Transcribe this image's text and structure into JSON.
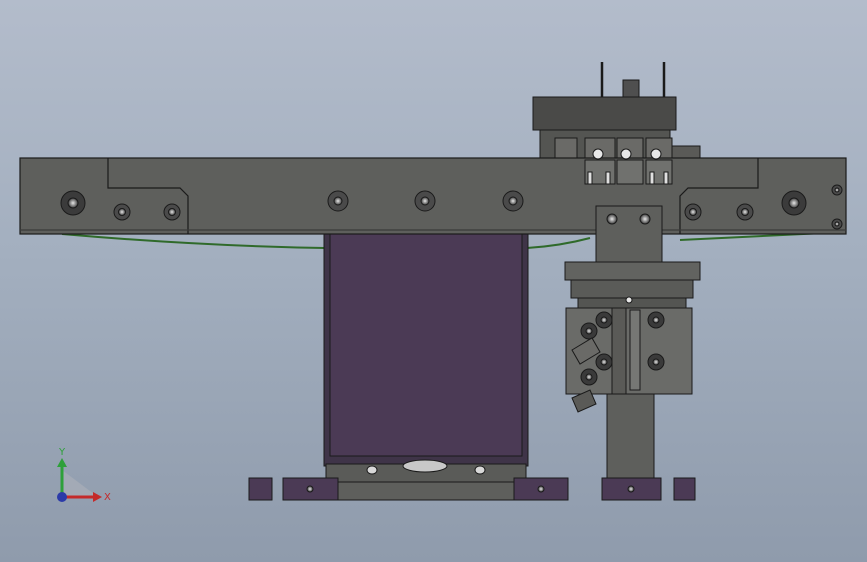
{
  "view": {
    "background_top": "#b3bccb",
    "background_bottom": "#8f9bac"
  },
  "model": {
    "body_color": "#5e5f5c",
    "motor_color": "#4b3a55",
    "edge_color": "#1a1a1a",
    "belt_color": "#2f6a2a"
  },
  "triad": {
    "y_label": "Y",
    "x_label": "X",
    "y_color": "#2ea03a",
    "x_color": "#c42a2a",
    "z_color": "#2b3aa8"
  }
}
